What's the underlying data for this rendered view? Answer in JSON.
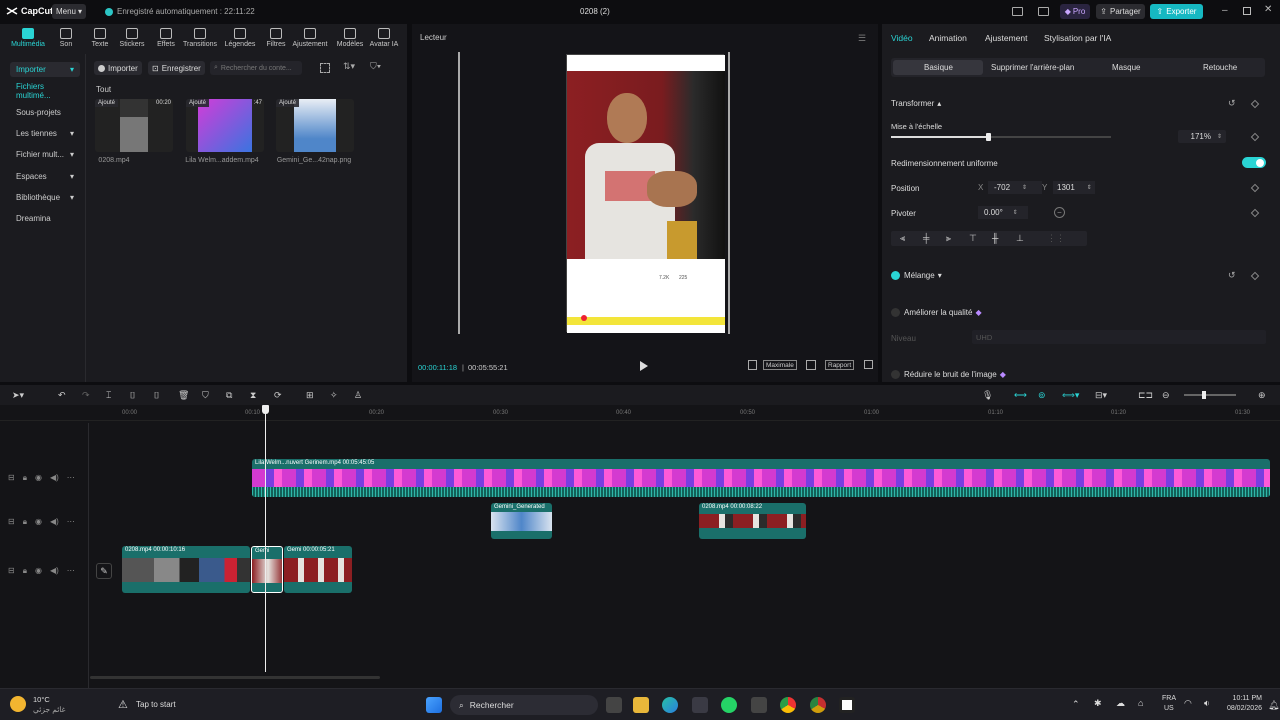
{
  "app": {
    "name": "CapCut",
    "menu_label": "Menu",
    "autosave": "Enregistré automatiquement : 22:11:22",
    "project_title": "0208 (2)",
    "pro_label": "Pro",
    "share_label": "Partager",
    "export_label": "Exporter",
    "accent_color": "#2ad4d4"
  },
  "toolbar": {
    "tools": [
      {
        "label": "Multimédia",
        "icon": "media-icon"
      },
      {
        "label": "Son",
        "icon": "audio-icon"
      },
      {
        "label": "Texte",
        "icon": "text-icon"
      },
      {
        "label": "Stickers",
        "icon": "sticker-icon"
      },
      {
        "label": "Effets",
        "icon": "effects-icon"
      },
      {
        "label": "Transitions",
        "icon": "transitions-icon"
      },
      {
        "label": "Légendes",
        "icon": "captions-icon"
      },
      {
        "label": "Filtres",
        "icon": "filters-icon"
      },
      {
        "label": "Ajustement",
        "icon": "adjust-icon"
      },
      {
        "label": "Modèles",
        "icon": "templates-icon"
      },
      {
        "label": "Avatar IA",
        "icon": "avatar-icon"
      }
    ]
  },
  "sidebar": {
    "items": [
      {
        "label": "Importer"
      },
      {
        "label": "Fichiers multimé..."
      },
      {
        "label": "Sous-projets"
      },
      {
        "label": "Les tiennes"
      },
      {
        "label": "Fichier mult..."
      },
      {
        "label": "Espaces"
      },
      {
        "label": "Bibliothèque"
      },
      {
        "label": "Dreamina"
      }
    ]
  },
  "media": {
    "import_label": "Importer",
    "record_label": "Enregistrer",
    "search_placeholder": "Rechercher du conte...",
    "filter_label": "Tout",
    "items": [
      {
        "badge": "Ajouté",
        "duration": "00:20",
        "name": "0208.mp4"
      },
      {
        "badge": "Ajouté",
        "duration": ":47",
        "name": "Lila Welm...addem.mp4"
      },
      {
        "badge": "Ajouté",
        "duration": "",
        "name": "Gemini_Ge...42nap.png"
      }
    ]
  },
  "player": {
    "title": "Lecteur",
    "current_time": "00:00:11:18",
    "total_time": "00:05:55:21",
    "zoom_label": "Maximale",
    "ratio_label": "Rapport",
    "likes": "7.2K",
    "comments": "225"
  },
  "props": {
    "tabs": [
      "Vidéo",
      "Animation",
      "Ajustement",
      "Stylisation par l'IA"
    ],
    "subtabs": [
      "Basique",
      "Supprimer l'arrière-plan",
      "Masque",
      "Retouche"
    ],
    "transform_label": "Transformer",
    "scale_label": "Mise à l'échelle",
    "scale_value": "171%",
    "scale_fraction": 0.44,
    "uniform_label": "Redimensionnement uniforme",
    "position_label": "Position",
    "pos_x_label": "X",
    "pos_x": "-702",
    "pos_y_label": "Y",
    "pos_y": "1301",
    "rotate_label": "Pivoter",
    "rotate_value": "0.00°",
    "blend_label": "Mélange",
    "enhance_label": "Améliorer la qualité",
    "level_label": "Niveau",
    "level_value": "UHD",
    "denoise_label": "Réduire le bruit de l'image"
  },
  "timeline": {
    "ticks": [
      "00:00",
      "00:10",
      "00:20",
      "00:30",
      "00:40",
      "00:50",
      "01:00",
      "01:10",
      "01:20",
      "01:30"
    ],
    "clips": {
      "main": "Lila Welm...nuvert Gerinem.mp4   00:05:45:05",
      "gemini": "Gemini_Generated",
      "overlay": "0208.mp4   00:00:08:22",
      "c1": "0208.mp4   00:00:10:16",
      "c2": "Gemi",
      "c3": "Gemi   00:00:05:21"
    }
  },
  "taskbar": {
    "weather_temp": "10°C",
    "weather_desc": "غائم جزئي",
    "tip": "Tap to start",
    "search": "Rechercher",
    "lang1": "FRA",
    "lang2": "US",
    "time": "10:11 PM",
    "date": "08/02/2026"
  }
}
